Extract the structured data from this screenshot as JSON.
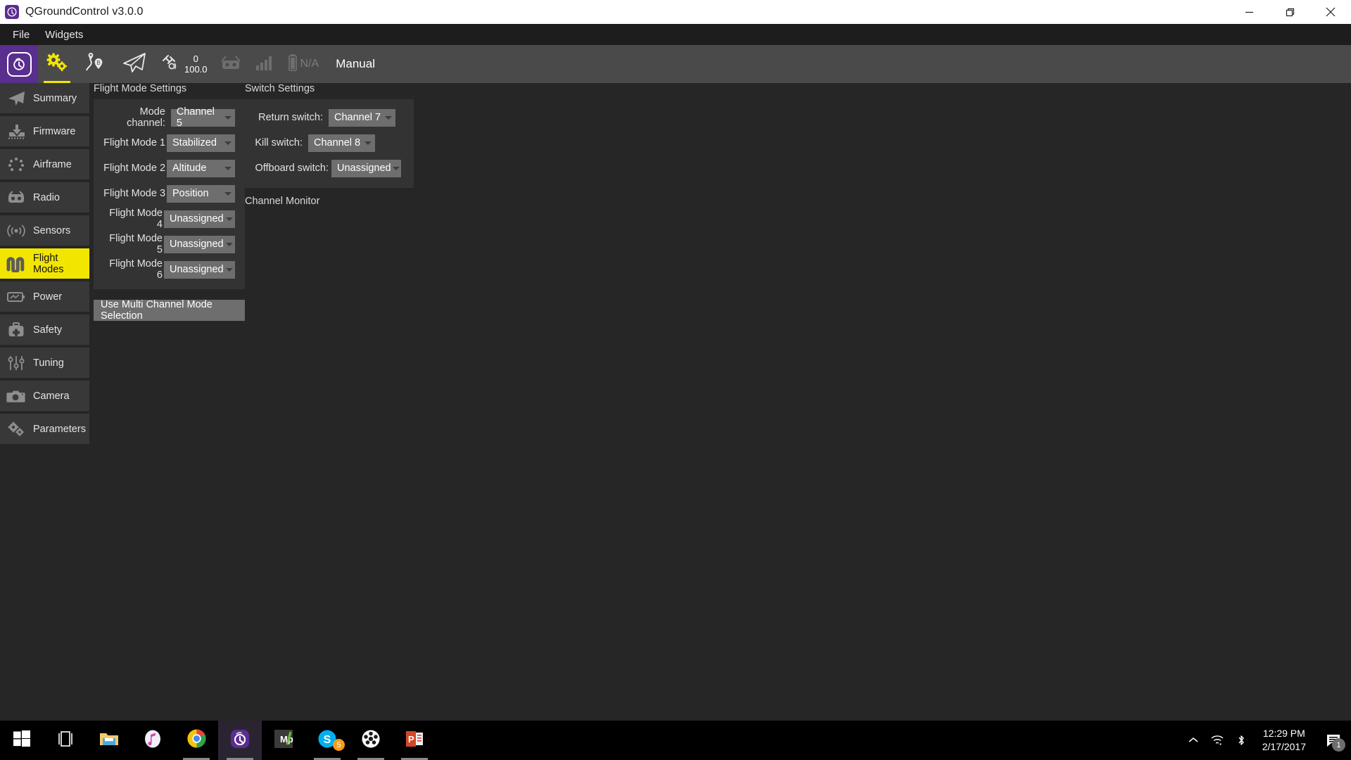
{
  "window": {
    "title": "QGroundControl v3.0.0",
    "icon": "qgc-logo-icon",
    "minimize_label": "Minimize",
    "restore_label": "Restore",
    "close_label": "Close"
  },
  "menubar": {
    "items": [
      {
        "label": "File"
      },
      {
        "label": "Widgets"
      }
    ]
  },
  "toolbar": {
    "logo_name": "qgc-logo-button",
    "items": [
      {
        "name": "gears-icon",
        "label": "Vehicle Setup",
        "active": true
      },
      {
        "name": "plan-waypoints-icon",
        "label": "Plan",
        "active": false
      },
      {
        "name": "paper-plane-icon",
        "label": "Fly",
        "active": false
      }
    ],
    "satellite": {
      "icon": "satellite-icon",
      "count": "0",
      "hdop": "100.0"
    },
    "rc_icon": "rc-transmitter-icon",
    "signal_icon": "signal-bars-icon",
    "battery": {
      "icon": "battery-icon",
      "value": "N/A"
    },
    "flight_mode": "Manual"
  },
  "sidebar": {
    "items": [
      {
        "label": "Summary",
        "icon": "paper-plane-icon",
        "selected": false
      },
      {
        "label": "Firmware",
        "icon": "firmware-download-icon",
        "selected": false
      },
      {
        "label": "Airframe",
        "icon": "airframe-dots-icon",
        "selected": false
      },
      {
        "label": "Radio",
        "icon": "radio-transmitter-icon",
        "selected": false
      },
      {
        "label": "Sensors",
        "icon": "sensors-waves-icon",
        "selected": false
      },
      {
        "label": "Flight Modes",
        "icon": "flight-modes-wave-icon",
        "selected": true
      },
      {
        "label": "Power",
        "icon": "power-battery-icon",
        "selected": false
      },
      {
        "label": "Safety",
        "icon": "safety-kit-icon",
        "selected": false
      },
      {
        "label": "Tuning",
        "icon": "tuning-sliders-icon",
        "selected": false
      },
      {
        "label": "Camera",
        "icon": "camera-icon",
        "selected": false
      },
      {
        "label": "Parameters",
        "icon": "parameters-gears-icon",
        "selected": false
      }
    ]
  },
  "main": {
    "flight_mode_settings": {
      "title": "Flight Mode Settings",
      "rows": [
        {
          "label": "Mode channel:",
          "value": "Channel 5"
        },
        {
          "label": "Flight Mode 1",
          "value": "Stabilized"
        },
        {
          "label": "Flight Mode 2",
          "value": "Altitude"
        },
        {
          "label": "Flight Mode 3",
          "value": "Position"
        },
        {
          "label": "Flight Mode 4",
          "value": "Unassigned"
        },
        {
          "label": "Flight Mode 5",
          "value": "Unassigned"
        },
        {
          "label": "Flight Mode 6",
          "value": "Unassigned"
        }
      ],
      "multi_channel_button": "Use Multi Channel Mode Selection"
    },
    "switch_settings": {
      "title": "Switch Settings",
      "rows": [
        {
          "label": "Return switch:",
          "value": "Channel 7"
        },
        {
          "label": "Kill switch:",
          "value": "Channel 8"
        },
        {
          "label": "Offboard switch:",
          "value": "Unassigned"
        }
      ]
    },
    "channel_monitor_title": "Channel Monitor"
  },
  "taskbar": {
    "start_label": "Start",
    "items": [
      {
        "name": "start-button",
        "label": "Start"
      },
      {
        "name": "task-view-button",
        "label": "Task View"
      },
      {
        "name": "file-explorer-button",
        "label": "File Explorer"
      },
      {
        "name": "itunes-button",
        "label": "iTunes"
      },
      {
        "name": "chrome-button",
        "label": "Google Chrome"
      },
      {
        "name": "qgroundcontrol-button",
        "label": "QGroundControl"
      },
      {
        "name": "mission-planner-button",
        "label": "Mission Planner"
      },
      {
        "name": "skype-button",
        "label": "Skype",
        "badge": "5"
      },
      {
        "name": "app-button",
        "label": "Application"
      },
      {
        "name": "powerpoint-button",
        "label": "PowerPoint"
      }
    ],
    "tray": {
      "show_hidden_label": "Show hidden icons",
      "network_label": "Network",
      "bluetooth_label": "Bluetooth",
      "time": "12:29 PM",
      "date": "2/17/2017",
      "notification_count": "1"
    }
  },
  "colors": {
    "accent_yellow": "#f2e600",
    "brand_purple": "#592e8e",
    "panel_bg": "#333333",
    "combo_bg": "#6e6e6e"
  }
}
